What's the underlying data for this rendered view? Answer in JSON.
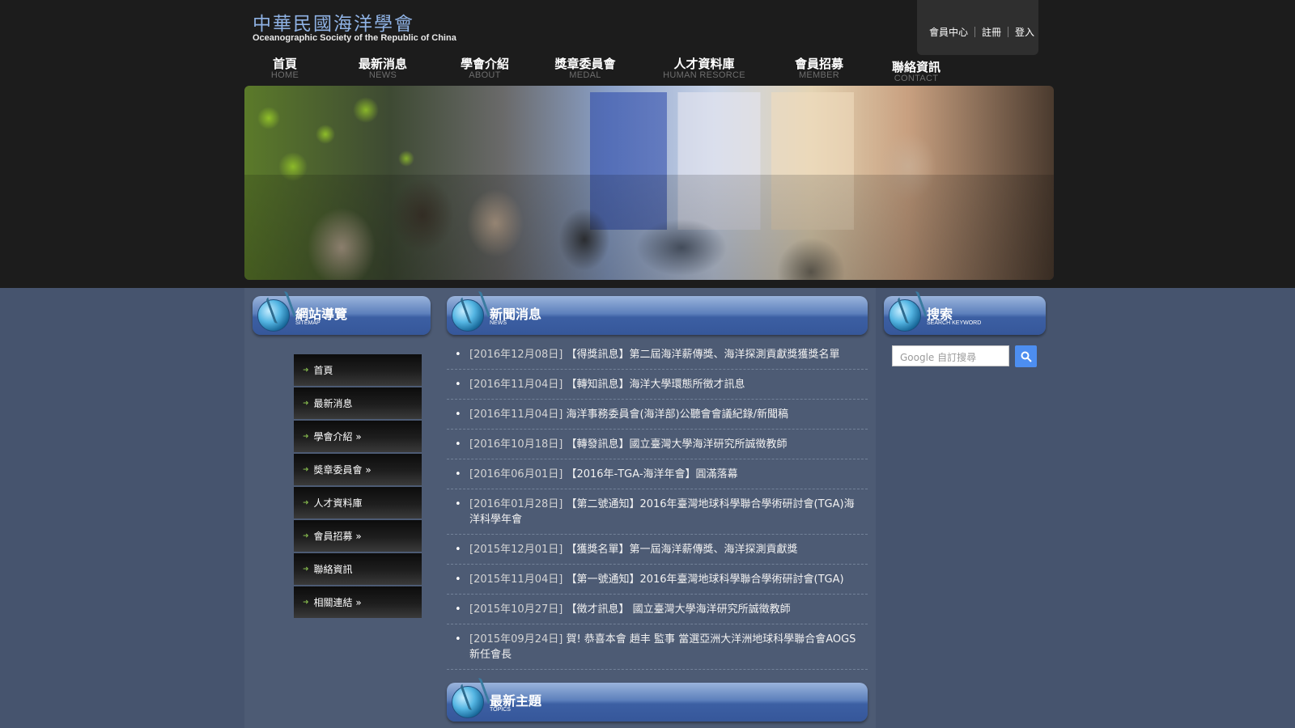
{
  "header": {
    "logo_zh": "中華民國海洋學會",
    "logo_en": "Oceanographic Society of the Republic of China",
    "member_links": [
      "會員中心",
      "註冊",
      "登入"
    ]
  },
  "nav": [
    {
      "zh": "首頁",
      "en": "HOME"
    },
    {
      "zh": "最新消息",
      "en": "NEWS"
    },
    {
      "zh": "學會介紹",
      "en": "ABOUT"
    },
    {
      "zh": "獎章委員會",
      "en": "MEDAL"
    },
    {
      "zh": "人才資料庫",
      "en": "HUMAN RESORCE"
    },
    {
      "zh": "會員招募",
      "en": "MEMBER"
    },
    {
      "zh": "聯絡資訊",
      "en": "CONTACT"
    }
  ],
  "sitemap": {
    "title": "網站導覽",
    "subtitle": "SITEMAP",
    "items": [
      "首頁",
      "最新消息",
      "學會介紹 »",
      "獎章委員會 »",
      "人才資料庫",
      "會員招募 »",
      "聯絡資訊",
      "相關連結 »"
    ]
  },
  "news": {
    "title": "新聞消息",
    "subtitle": "NEWS",
    "items": [
      {
        "date": "[2016年12月08日]",
        "text": "【得獎訊息】第二屆海洋薪傳獎、海洋探測貢獻獎獲獎名單"
      },
      {
        "date": "[2016年11月04日]",
        "text": "【轉知訊息】海洋大學環態所徵才訊息"
      },
      {
        "date": "[2016年11月04日]",
        "text": "海洋事務委員會(海洋部)公聽會會議紀錄/新聞稿"
      },
      {
        "date": "[2016年10月18日]",
        "text": "【轉發訊息】國立臺灣大學海洋研究所誠徵教師"
      },
      {
        "date": "[2016年06月01日]",
        "text": "【2016年-TGA-海洋年會】圓滿落幕"
      },
      {
        "date": "[2016年01月28日]",
        "text": "【第二號通知】2016年臺灣地球科學聯合學術研討會(TGA)海洋科學年會"
      },
      {
        "date": "[2015年12月01日]",
        "text": "【獲獎名單】第一屆海洋薪傳獎、海洋探測貢獻獎"
      },
      {
        "date": "[2015年11月04日]",
        "text": "【第一號通知】2016年臺灣地球科學聯合學術研討會(TGA)"
      },
      {
        "date": "[2015年10月27日]",
        "text": "【徵才訊息】 國立臺灣大學海洋研究所誠徵教師"
      },
      {
        "date": "[2015年09月24日]",
        "text": "賀! 恭喜本會 趙丰 監事 當選亞洲大洋洲地球科學聯合會AOGS新任會長"
      }
    ]
  },
  "topics": {
    "title": "最新主題",
    "subtitle": "TOPICS"
  },
  "search": {
    "title": "搜索",
    "subtitle": "SEARCH KEYWORD",
    "placeholder": "Google 自訂搜尋"
  },
  "colors": {
    "header_bg": "#1c1c1c",
    "body_bg": "#46546e",
    "section_header": "#3c5fa3",
    "logo": "#8fb2e4",
    "search_button": "#4d8ef0"
  }
}
